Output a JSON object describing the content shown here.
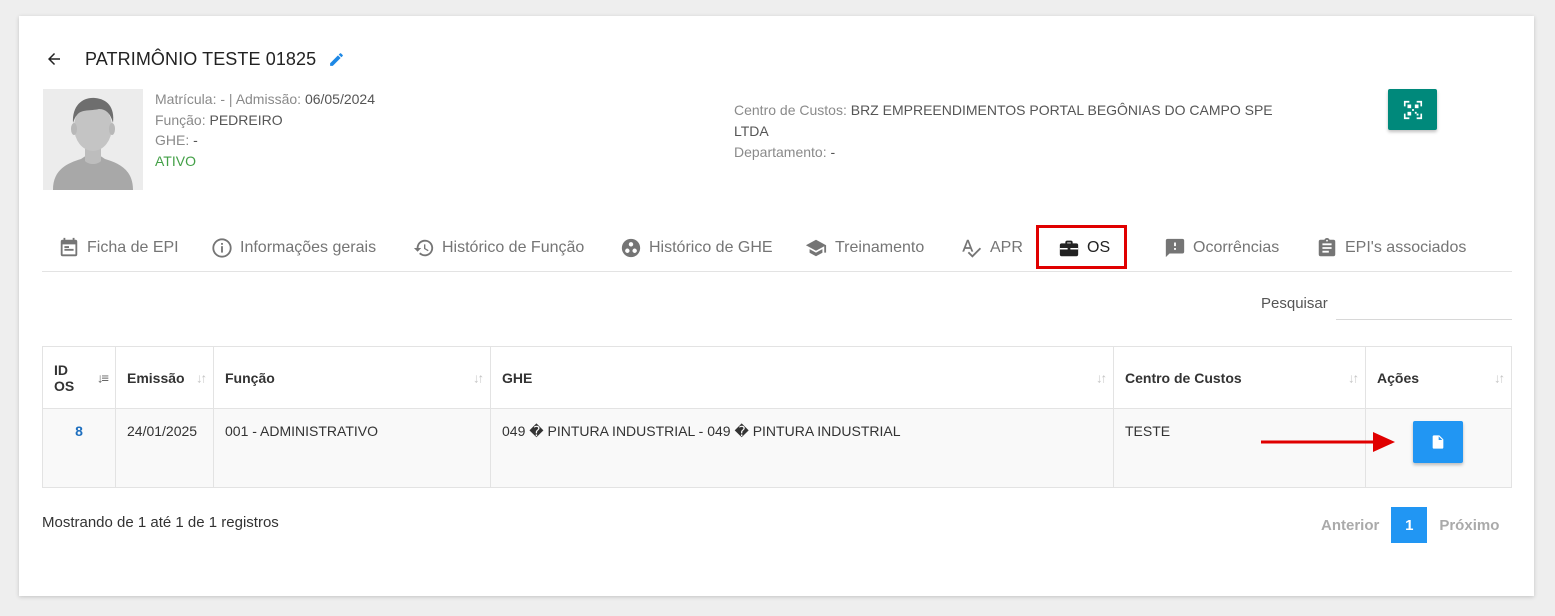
{
  "header": {
    "title": "PATRIMÔNIO TESTE 01825"
  },
  "employee": {
    "matricula_label": "Matrícula:",
    "matricula_value": "-",
    "separator": "|",
    "admissao_label": "Admissão:",
    "admissao_value": "06/05/2024",
    "funcao_label": "Função:",
    "funcao_value": "PEDREIRO",
    "ghe_label": "GHE:",
    "ghe_value": "-",
    "status": "ATIVO",
    "centro_label": "Centro de Custos:",
    "centro_value": "BRZ EMPREENDIMENTOS PORTAL BEGÔNIAS DO CAMPO SPE LTDA",
    "departamento_label": "Departamento:",
    "departamento_value": "-"
  },
  "tabs": [
    {
      "label": "Ficha de EPI",
      "icon": "calendar-icon"
    },
    {
      "label": "Informações gerais",
      "icon": "info-icon"
    },
    {
      "label": "Histórico de Função",
      "icon": "history-icon"
    },
    {
      "label": "Histórico de GHE",
      "icon": "group-icon"
    },
    {
      "label": "Treinamento",
      "icon": "school-icon"
    },
    {
      "label": "APR",
      "icon": "spellcheck-icon"
    },
    {
      "label": "OS",
      "icon": "briefcase-icon",
      "active": true
    },
    {
      "label": "Ocorrências",
      "icon": "report-icon"
    },
    {
      "label": "EPI's associados",
      "icon": "clipboard-icon"
    }
  ],
  "search": {
    "label": "Pesquisar",
    "value": ""
  },
  "table": {
    "columns": [
      "ID OS",
      "Emissão",
      "Função",
      "GHE",
      "Centro de Custos",
      "Ações"
    ],
    "column_id_line1": "ID",
    "column_id_line2": "OS",
    "rows": [
      {
        "id": "8",
        "emissao": "24/01/2025",
        "funcao": "001 - ADMINISTRATIVO",
        "ghe": "049 � PINTURA INDUSTRIAL - 049 � PINTURA INDUSTRIAL",
        "centro": "TESTE"
      }
    ]
  },
  "footer": {
    "info": "Mostrando de 1 até 1 de 1 registros",
    "prev": "Anterior",
    "page": "1",
    "next": "Próximo"
  },
  "colors": {
    "primary": "#2196f3",
    "teal": "#00897b",
    "active_status": "#43a047",
    "highlight": "#e00000"
  }
}
